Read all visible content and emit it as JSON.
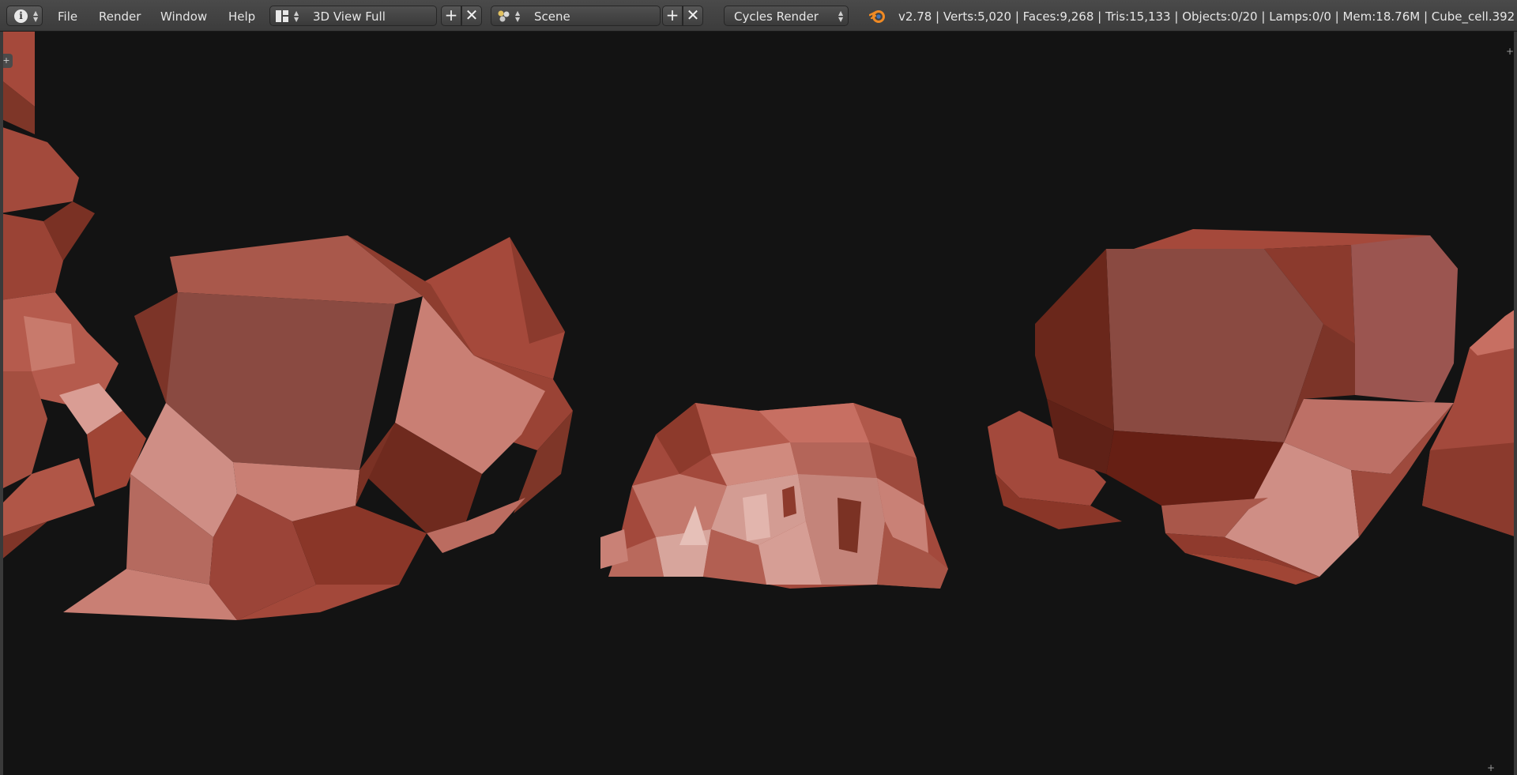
{
  "menu": {
    "editor_type_icon": "info-icon",
    "items": [
      "File",
      "Render",
      "Window",
      "Help"
    ]
  },
  "screen_layout": {
    "value": "3D View Full",
    "add_icon": "plus-icon",
    "remove_icon": "x-icon"
  },
  "scene": {
    "value": "Scene",
    "add_icon": "plus-icon",
    "remove_icon": "x-icon"
  },
  "render_engine": {
    "value": "Cycles Render"
  },
  "stats": {
    "text": "v2.78 | Verts:5,020 | Faces:9,268 | Tris:15,133 | Objects:0/20 | Lamps:0/0 | Mem:18.76M | Cube_cell.392"
  },
  "viewport": {
    "background_color": "#131313",
    "object_color": "#9a4a3e",
    "objects": [
      "rock-cluster-left-edge",
      "rock-cluster-left",
      "rock-cluster-center",
      "rock-cluster-right"
    ]
  }
}
